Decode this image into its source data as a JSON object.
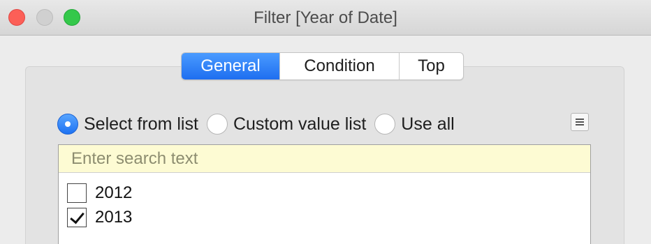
{
  "window": {
    "title": "Filter [Year of Date]",
    "controls": {
      "close": "close-icon",
      "minimize": "minimize-icon",
      "zoom": "zoom-icon"
    }
  },
  "tabs": [
    {
      "label": "General",
      "active": true
    },
    {
      "label": "Condition",
      "active": false
    },
    {
      "label": "Top",
      "active": false
    }
  ],
  "selection_mode": {
    "options": [
      {
        "label": "Select from list",
        "checked": true
      },
      {
        "label": "Custom value list",
        "checked": false
      },
      {
        "label": "Use all",
        "checked": false
      }
    ],
    "menu_icon": "list-menu-icon"
  },
  "search": {
    "placeholder": "Enter search text",
    "value": ""
  },
  "list": {
    "items": [
      {
        "label": "2012",
        "checked": false
      },
      {
        "label": "2013",
        "checked": true
      }
    ]
  },
  "colors": {
    "accent": "#1e6ef0",
    "close": "#fc5f57",
    "zoom": "#34c84a",
    "search_bg": "#fdfbd3"
  }
}
